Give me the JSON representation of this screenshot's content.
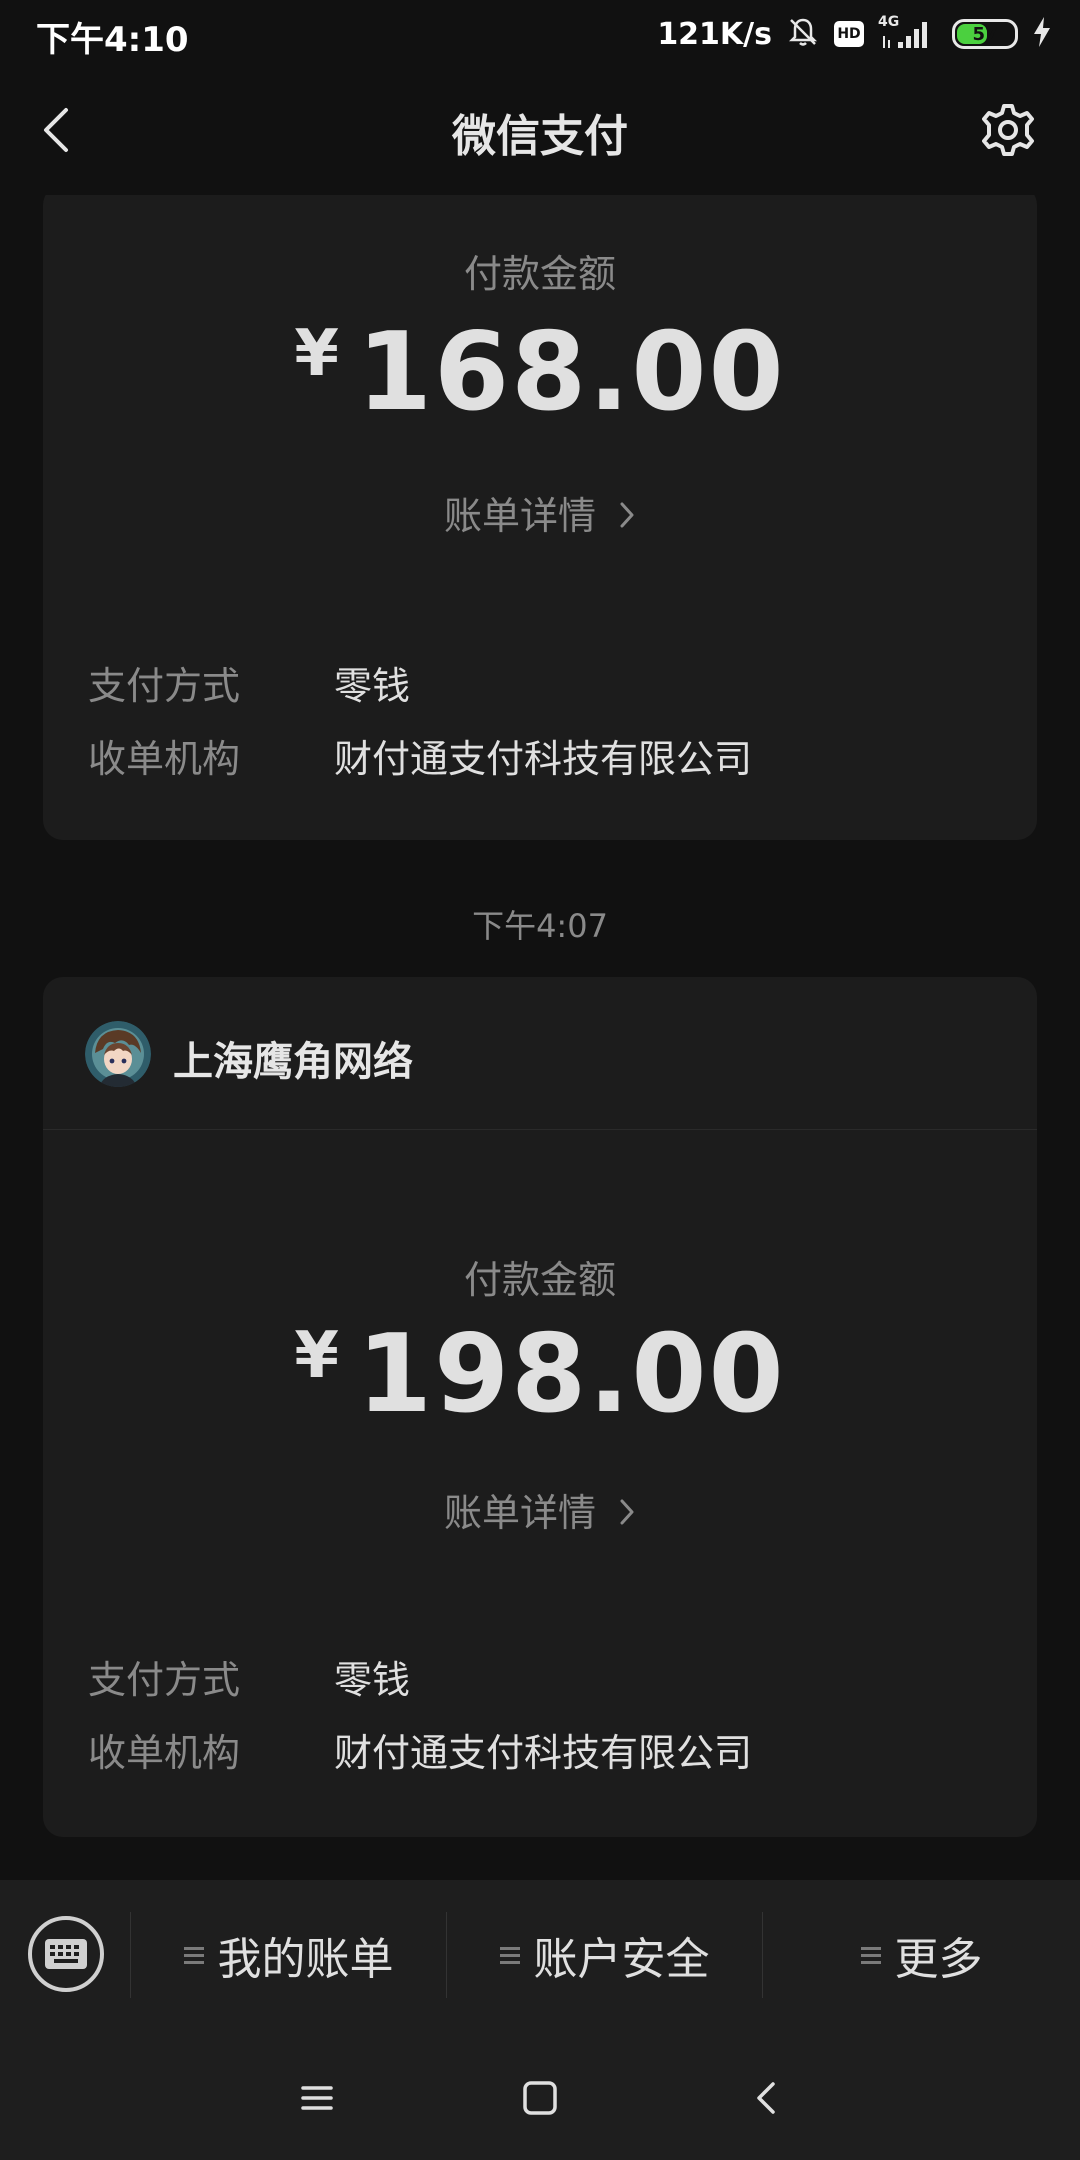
{
  "status_bar": {
    "time": "下午4:10",
    "net_speed": "121K/s",
    "hd_label": "HD",
    "network_type": "4G",
    "battery_level": "57",
    "battery_fraction": 0.57,
    "icons": [
      "bell-off-icon",
      "hd-icon",
      "signal-icon",
      "battery-icon",
      "charging-icon"
    ]
  },
  "nav": {
    "title": "微信支付",
    "back_icon": "chevron-left-icon",
    "settings_icon": "gear-icon"
  },
  "transactions": [
    {
      "amount_label": "付款金额",
      "currency": "¥",
      "amount": "168.00",
      "bill_details_label": "账单详情",
      "payment_method_key": "支付方式",
      "payment_method_value": "零钱",
      "acquirer_key": "收单机构",
      "acquirer_value": "财付通支付科技有限公司"
    },
    {
      "time": "下午4:07",
      "merchant": "上海鹰角网络",
      "amount_label": "付款金额",
      "currency": "¥",
      "amount": "198.00",
      "bill_details_label": "账单详情",
      "payment_method_key": "支付方式",
      "payment_method_value": "零钱",
      "acquirer_key": "收单机构",
      "acquirer_value": "财付通支付科技有限公司"
    }
  ],
  "bottom_menu": {
    "keyboard_icon": "keyboard-icon",
    "items": [
      {
        "label": "我的账单"
      },
      {
        "label": "账户安全"
      },
      {
        "label": "更多"
      }
    ]
  },
  "system_nav": {
    "icons": [
      "menu-icon",
      "home-icon",
      "back-icon"
    ]
  },
  "colors": {
    "background": "#111111",
    "card": "#1c1c1c",
    "bottom_bar": "#1e1e1e",
    "primary_text": "#e0e0e0",
    "secondary_text": "#8a8a8a",
    "battery": "#4bd03f"
  }
}
